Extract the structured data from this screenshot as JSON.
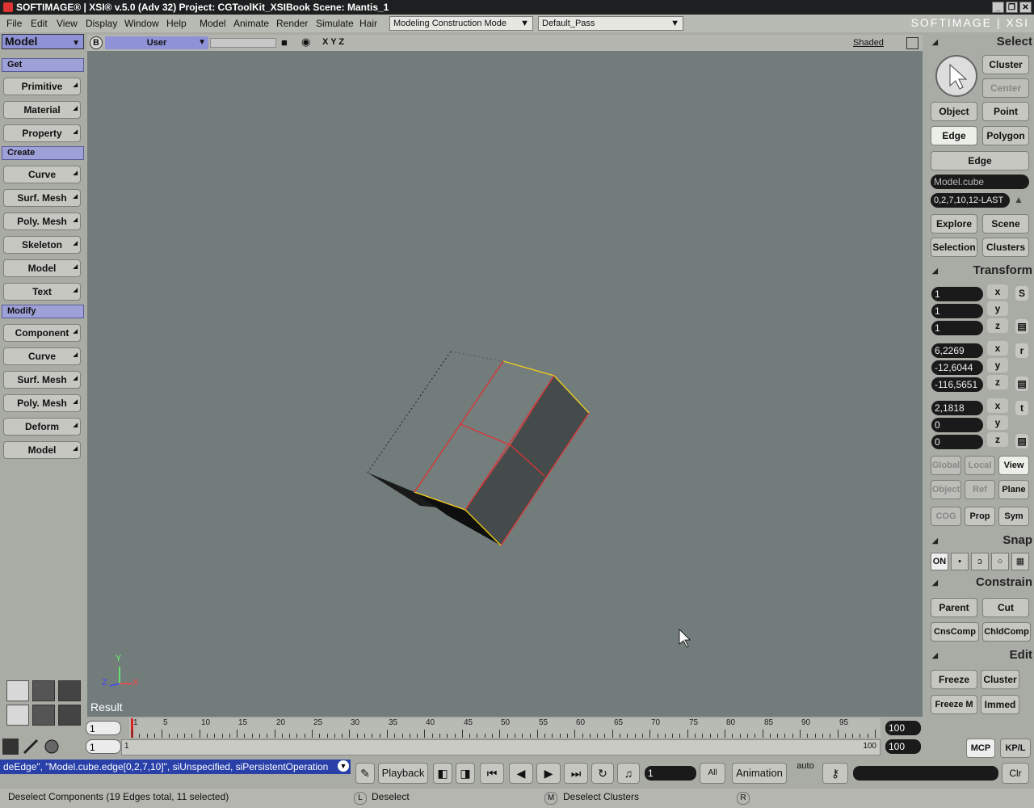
{
  "titlebar": {
    "title": "SOFTIMAGE® | XSI® v.5.0 (Adv 32) Project: CGToolKit_XSIBook    Scene: Mantis_1",
    "minimize": "_",
    "restore": "❐",
    "close": "✕"
  },
  "menubar": {
    "items": [
      "File",
      "Edit",
      "View",
      "Display",
      "Window",
      "Help"
    ],
    "modules": [
      "Model",
      "Animate",
      "Render",
      "Simulate",
      "Hair"
    ],
    "construction_mode": "Modeling Construction Mode",
    "pass": "Default_Pass",
    "logo": "SOFTIMAGE | XSI"
  },
  "left": {
    "module": "Model",
    "get_label": "Get",
    "get": [
      "Primitive",
      "Material",
      "Property"
    ],
    "create_label": "Create",
    "create": [
      "Curve",
      "Surf. Mesh",
      "Poly. Mesh",
      "Skeleton",
      "Model",
      "Text"
    ],
    "modify_label": "Modify",
    "modify": [
      "Component",
      "Curve",
      "Surf. Mesh",
      "Poly. Mesh",
      "Deform",
      "Model"
    ]
  },
  "viewport": {
    "badge": "B",
    "camera": "User",
    "axes_label": "X Y Z",
    "display_mode": "Shaded",
    "result_label": "Result",
    "axis_x": "X",
    "axis_y": "Y",
    "axis_z": "Z"
  },
  "right": {
    "select_header": "Select",
    "cluster": "Cluster",
    "center": "Center",
    "object": "Object",
    "point": "Point",
    "edge": "Edge",
    "polygon": "Polygon",
    "edge_filter": "Edge",
    "selection_name": "Model.cube",
    "selection_indices": "0,2,7,10,12-LAST",
    "explore": "Explore",
    "scene": "Scene",
    "selection": "Selection",
    "clusters": "Clusters",
    "transform_header": "Transform",
    "scale": [
      "1",
      "1",
      "1"
    ],
    "rotate": [
      "6,2269",
      "-12,6044",
      "-116,5651"
    ],
    "translate": [
      "2,1818",
      "0",
      "0"
    ],
    "axes": [
      "x",
      "y",
      "z"
    ],
    "s_label": "S",
    "r_label": "r",
    "t_label": "t",
    "global": "Global",
    "local": "Local",
    "view": "View",
    "object_ref": "Object",
    "ref": "Ref",
    "plane": "Plane",
    "cog": "COG",
    "prop": "Prop",
    "sym": "Sym",
    "snap_header": "Snap",
    "snap_on": "ON",
    "constrain_header": "Constrain",
    "parent": "Parent",
    "cut": "Cut",
    "cnscomp": "CnsComp",
    "chldcomp": "ChldComp",
    "edit_header": "Edit",
    "freeze": "Freeze",
    "edit_cluster": "Cluster",
    "freeze_m": "Freeze M",
    "immed": "Immed"
  },
  "timeline": {
    "start": "1",
    "end": "100",
    "current": "1",
    "range_end": "100",
    "range_start_lbl": "1",
    "range_end_lbl": "100",
    "ticks": [
      "1",
      "5",
      "10",
      "15",
      "20",
      "25",
      "30",
      "35",
      "40",
      "45",
      "50",
      "55",
      "60",
      "65",
      "70",
      "75",
      "80",
      "85",
      "90",
      "95"
    ],
    "mcp": "MCP",
    "kpl": "KP/L"
  },
  "playback": {
    "command": "deEdge\", \"Model.cube.edge[0,2,7,10]\", siUnspecified, siPersistentOperation",
    "playback_label": "Playback",
    "frame": "1",
    "all": "All",
    "animation": "Animation",
    "auto": "auto",
    "clr": "Clr"
  },
  "status": {
    "message": "Deselect Components (19 Edges total, 11 selected)",
    "l_key": "L",
    "l_action": "Deselect",
    "m_key": "M",
    "m_action": "Deselect Clusters",
    "r_key": "R"
  }
}
